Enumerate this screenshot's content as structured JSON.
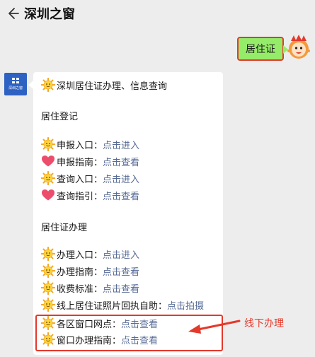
{
  "header": {
    "title": "深圳之窗"
  },
  "user_message": {
    "text": "居住证"
  },
  "bot": {
    "avatar_text": "深圳之窗",
    "heading": "深圳居住证办理、信息查询",
    "section1_title": "居住登记",
    "section1_items": [
      {
        "icon": "sun-icon",
        "label": "申报入口：",
        "link": "点击进入"
      },
      {
        "icon": "heart-icon",
        "label": "申报指南：",
        "link": "点击查看"
      },
      {
        "icon": "sun-icon",
        "label": "查询入口：",
        "link": "点击进入"
      },
      {
        "icon": "heart-icon",
        "label": "查询指引：",
        "link": "点击查看"
      }
    ],
    "section2_title": "居住证办理",
    "section2_items": [
      {
        "icon": "sun-icon",
        "label": "办理入口：",
        "link": "点击进入"
      },
      {
        "icon": "sun-icon",
        "label": "办理指南：",
        "link": "点击查看"
      },
      {
        "icon": "sun-icon",
        "label": "收费标准：",
        "link": "点击查看"
      },
      {
        "icon": "sun-icon",
        "label": "线上居住证照片回执自助：",
        "link": "点击拍摄"
      },
      {
        "icon": "sun-icon",
        "label": "各区窗口网点：",
        "link": "点击查看"
      },
      {
        "icon": "sun-icon",
        "label": "窗口办理指南：",
        "link": "点击查看"
      }
    ]
  },
  "annotation": {
    "text": "线下办理"
  },
  "colors": {
    "accent_red": "#e4392b",
    "link_blue": "#576b95",
    "bubble_green": "#95ec69"
  }
}
